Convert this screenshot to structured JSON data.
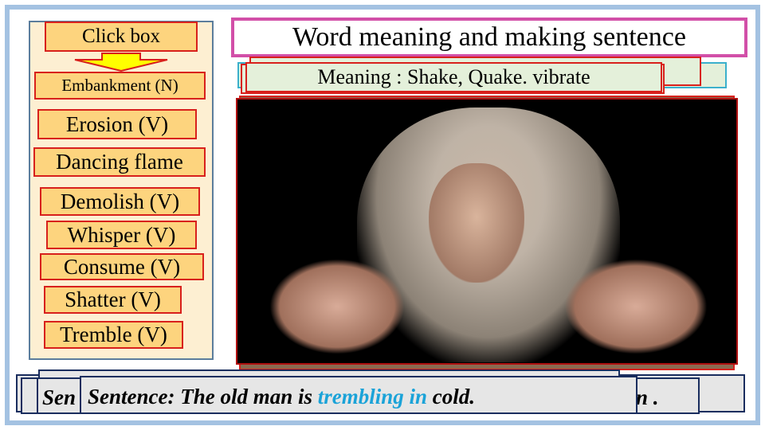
{
  "title": "Word meaning and making sentence",
  "sidebar": {
    "header": "Click box",
    "items": [
      "Embankment (N)",
      "Erosion (V)",
      "Dancing flame",
      "Demolish (V)",
      "Whisper (V)",
      "Consume (V)",
      "Shatter (V)",
      "Tremble (V)"
    ]
  },
  "meaning": "Meaning : Shake, Quake. vibrate",
  "sentence": {
    "behind_prefix": "Sen",
    "behind_suffix": "n .",
    "prefix": "Sentence: The  old man is ",
    "highlight": "trembling in",
    "suffix": " cold.",
    "highlight_color": "#1ba3d8"
  },
  "image": {
    "subject": "old woman with white hair trembling"
  }
}
